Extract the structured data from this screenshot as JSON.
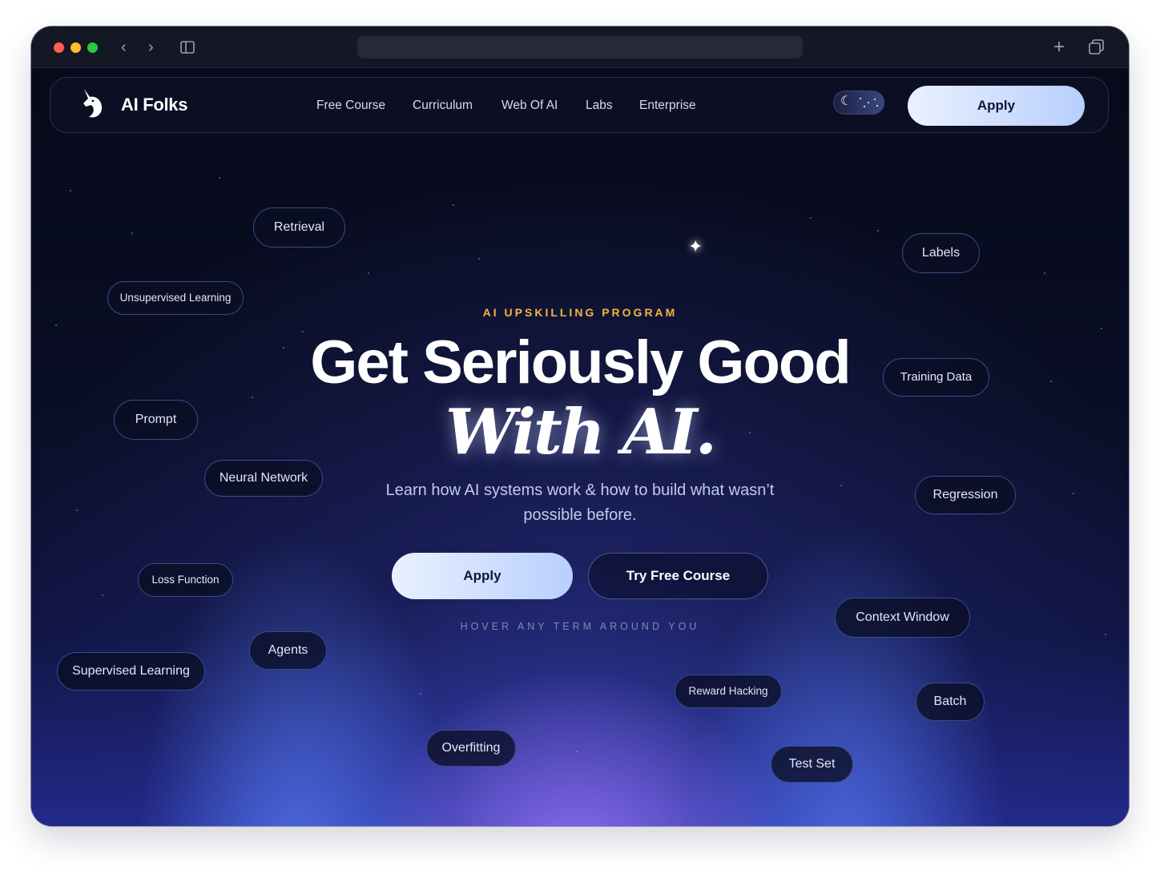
{
  "nav": {
    "brand": "AI Folks",
    "links": [
      "Free Course",
      "Curriculum",
      "Web Of AI",
      "Labs",
      "Enterprise"
    ],
    "apply": "Apply"
  },
  "hero": {
    "eyebrow": "AI UPSKILLING PROGRAM",
    "headline_line1": "Get Seriously Good",
    "headline_line2": "With AI.",
    "subtitle": "Learn how AI systems work & how to build what wasn’t possible before.",
    "apply": "Apply",
    "free_course": "Try Free Course",
    "hint": "HOVER ANY TERM AROUND YOU"
  },
  "terms": {
    "retrieval": "Retrieval",
    "unsupervised_learning": "Unsupervised Learning",
    "prompt": "Prompt",
    "neural_network": "Neural Network",
    "loss_function": "Loss Function",
    "agents": "Agents",
    "supervised_learning": "Supervised Learning",
    "overfitting": "Overfitting",
    "labels": "Labels",
    "training_data": "Training Data",
    "regression": "Regression",
    "context_window": "Context Window",
    "reward_hacking": "Reward Hacking",
    "batch": "Batch",
    "test_set": "Test Set"
  },
  "colors": {
    "eyebrow": "#f2b63d",
    "background": "#070a1c",
    "button_gradient_start": "#eaf1ff",
    "button_gradient_end": "#b8cffd"
  },
  "icons": [
    "back-icon",
    "forward-icon",
    "sidebar-icon",
    "new-tab-icon",
    "tabs-overview-icon",
    "unicorn-logo-icon",
    "moon-icon",
    "sparkle-icon"
  ]
}
